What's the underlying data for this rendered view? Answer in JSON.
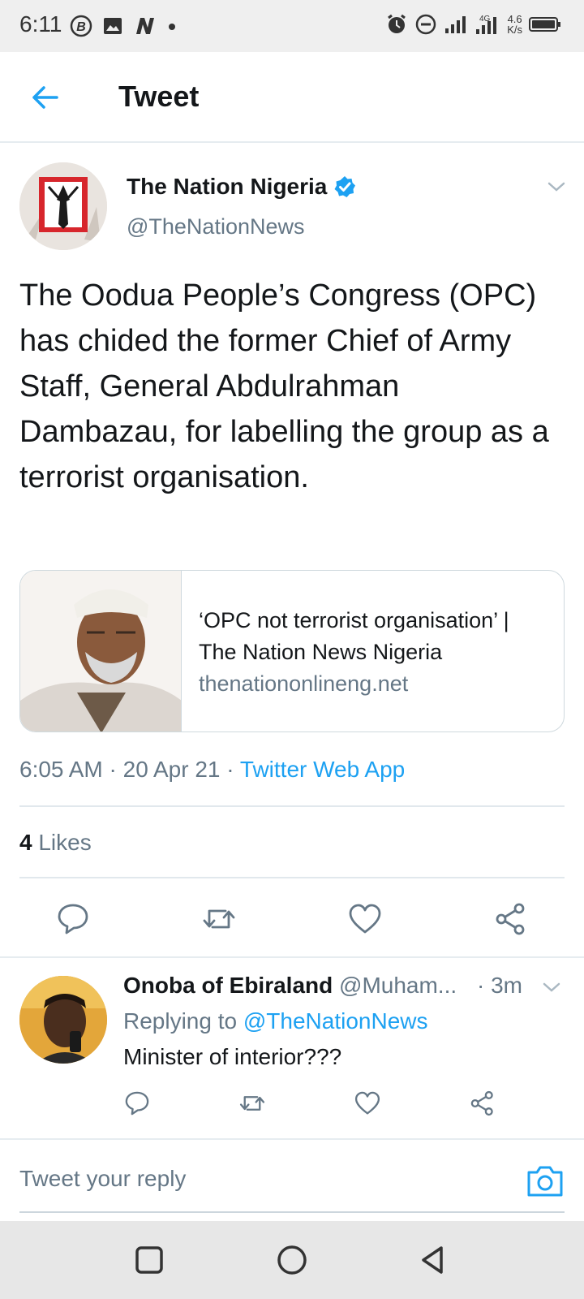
{
  "status_bar": {
    "time": "6:11",
    "network_speed_value": "4.6",
    "network_speed_unit": "K/s",
    "network_type": "4G",
    "icons": [
      "b-circle-icon",
      "image-icon",
      "n-app-icon",
      "dot-icon",
      "alarm-icon",
      "dnd-icon",
      "signal-icon",
      "signal-4g-icon",
      "battery-icon"
    ]
  },
  "header": {
    "title": "Tweet",
    "back_icon": "arrow-left-icon"
  },
  "tweet": {
    "author_name": "The Nation Nigeria",
    "verified": true,
    "author_handle": "@TheNationNews",
    "text": "The Oodua People’s Congress (OPC) has chided the former Chief of Army Staff, General Abdulrahman Dambazau, for labelling the group as a terrorist organisation.",
    "card": {
      "title": "‘OPC not terrorist organisation’ | The Nation News Nigeria",
      "domain": "thenationonlineng.net"
    },
    "time": "6:05 AM",
    "date": "20 Apr 21",
    "separator": "·",
    "source": "Twitter Web App",
    "likes_count": "4",
    "likes_label": "Likes"
  },
  "reply": {
    "author_name": "Onoba of Ebiraland",
    "author_handle": "@Muham...",
    "time": "· 3m",
    "replying_prefix": "Replying to",
    "replying_to": "@TheNationNews",
    "text": "Minister of interior???"
  },
  "compose": {
    "placeholder": "Tweet your reply"
  },
  "colors": {
    "accent": "#1da1f2",
    "secondary_text": "#657786",
    "primary_text": "#14171a"
  }
}
